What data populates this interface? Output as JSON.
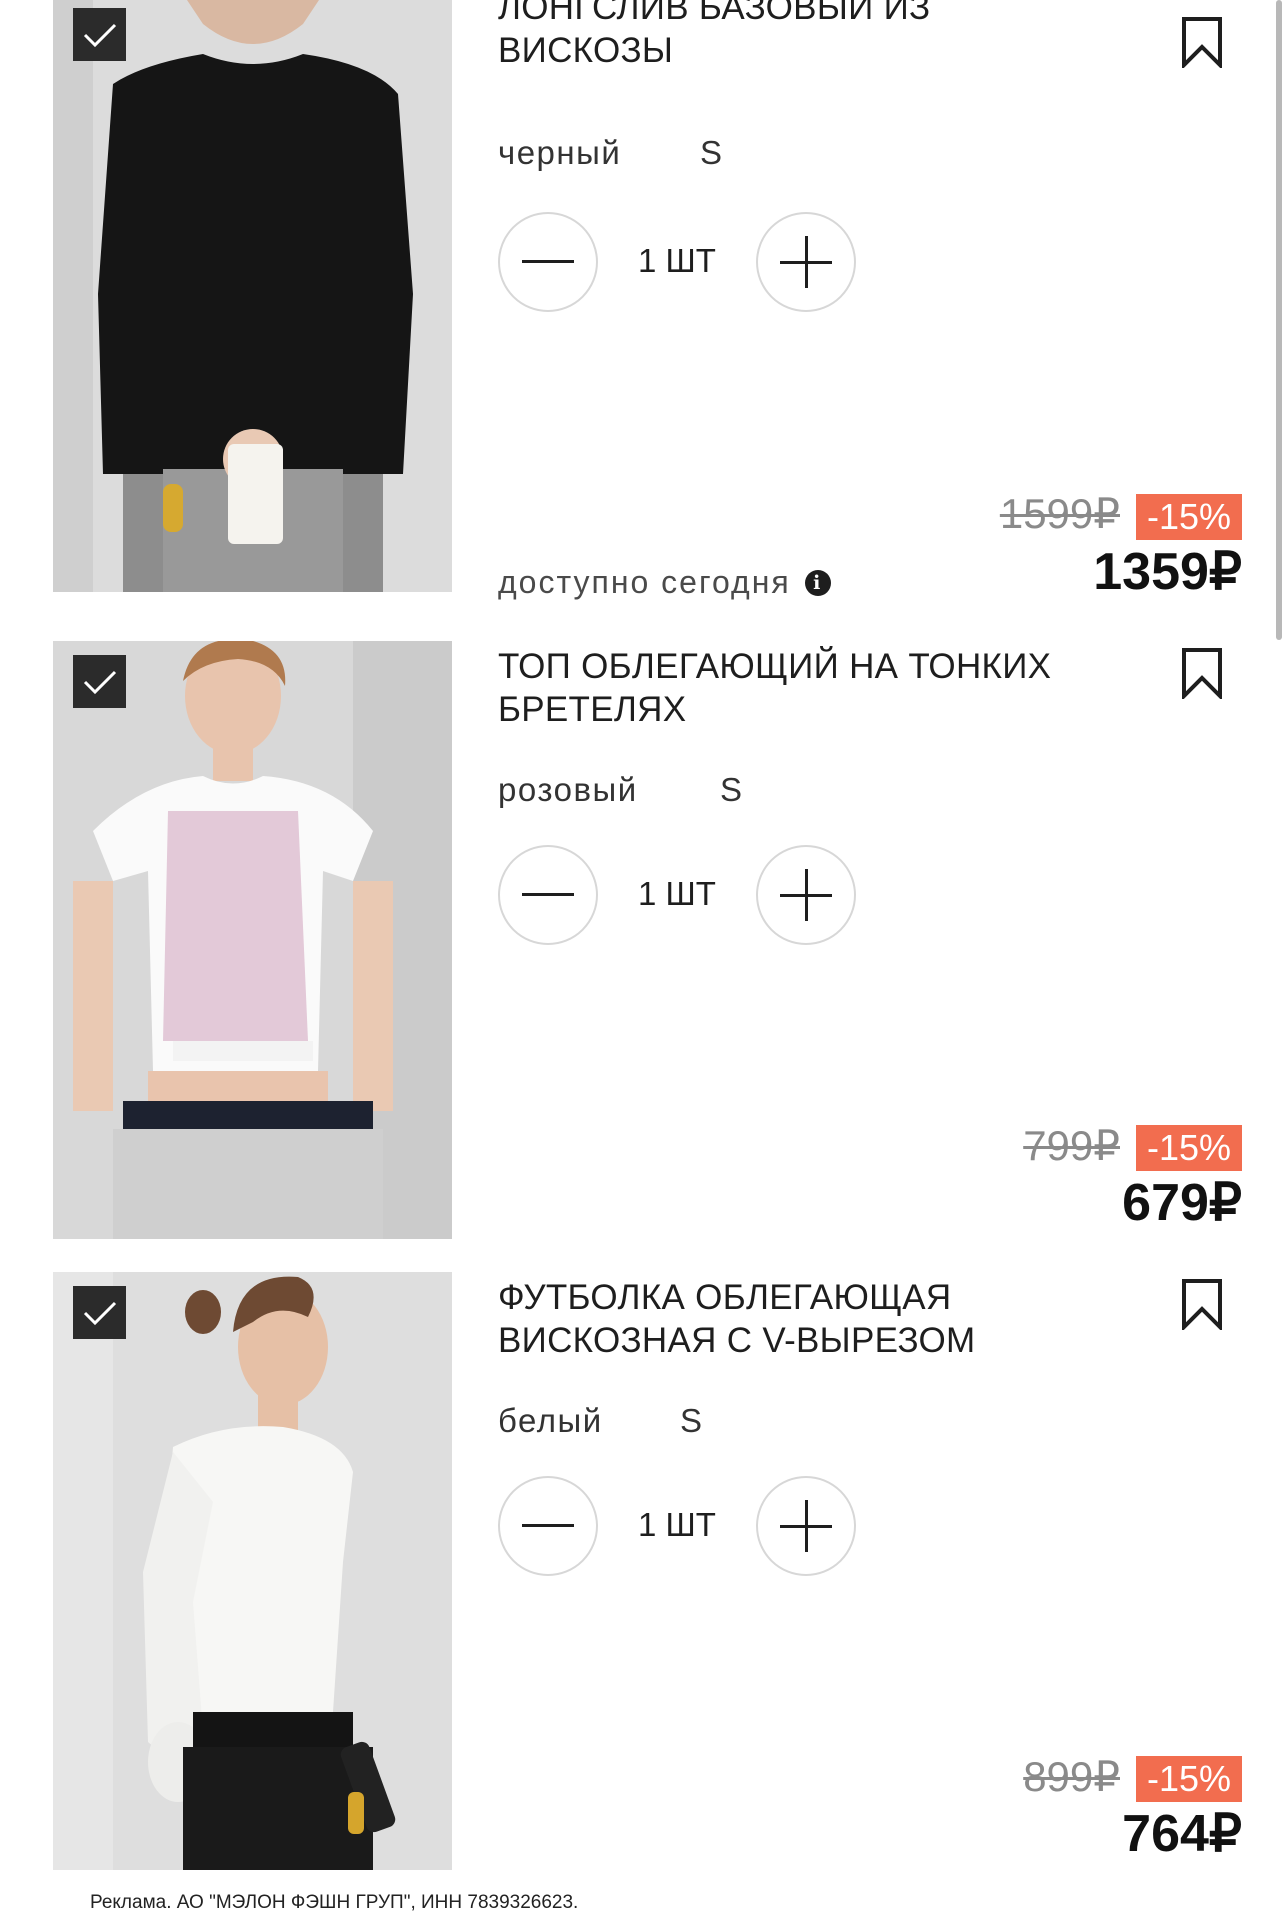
{
  "items": [
    {
      "title": "ЛОНГСЛИВ БАЗОВЫЙ ИЗ ВИСКОЗЫ",
      "color": "черный",
      "size": "S",
      "quantity": "1 ШТ",
      "old_price": "1599₽",
      "discount": "-15%",
      "price": "1359₽",
      "availability": "доступно сегодня",
      "selected": true
    },
    {
      "title": "ТОП ОБЛЕГАЮЩИЙ НА ТОНКИХ БРЕТЕЛЯХ",
      "color": "розовый",
      "size": "S",
      "quantity": "1 ШТ",
      "old_price": "799₽",
      "discount": "-15%",
      "price": "679₽",
      "selected": true
    },
    {
      "title": "ФУТБОЛКА ОБЛЕГАЮЩАЯ ВИСКОЗНАЯ С V-ВЫРЕЗОМ",
      "color": "белый",
      "size": "S",
      "quantity": "1 ШТ",
      "old_price": "899₽",
      "discount": "-15%",
      "price": "764₽",
      "selected": true
    }
  ],
  "footer": {
    "ad_text": "Реклама. АО \"МЭЛОН ФЭШН ГРУП\", ИНН 7839326623."
  },
  "colors": {
    "discount_badge": "#f26d4f",
    "checkbox": "#2b2b2b"
  },
  "icons": [
    "check-icon",
    "bookmark-icon",
    "minus-icon",
    "plus-icon",
    "info-icon"
  ]
}
